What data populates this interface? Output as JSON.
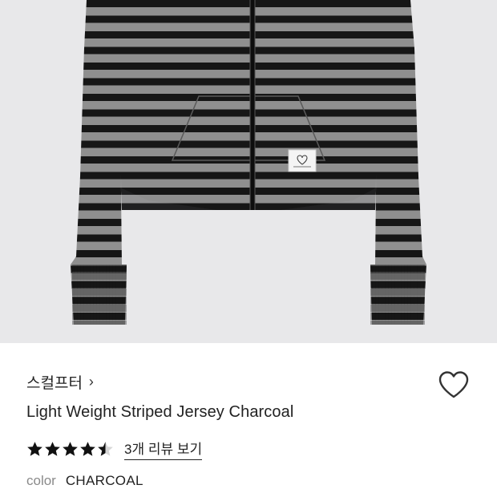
{
  "brand": {
    "name": "스컬프터",
    "chevron": "›"
  },
  "product": {
    "title": "Light Weight Striped Jersey Charcoal"
  },
  "rating": {
    "stars": 4.5,
    "max": 5,
    "review_link": "3개 리뷰 보기"
  },
  "color": {
    "label": "color",
    "value": "CHARCOAL"
  },
  "icons": {
    "wishlist": "heart-outline-icon",
    "star": "star-icon"
  },
  "colors": {
    "stripe_dark": "#161616",
    "stripe_light": "#8e8e8e",
    "background": "#e8e8ea"
  }
}
